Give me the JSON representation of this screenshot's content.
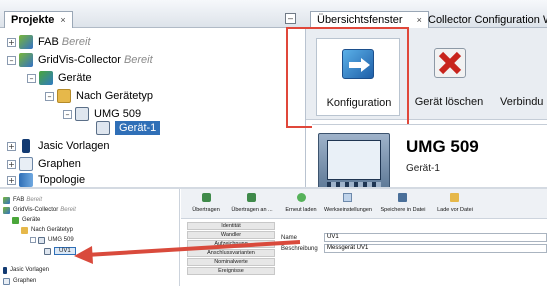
{
  "top_left": {
    "panel_title": "Projekte",
    "tab_close": "×",
    "minimize": "–",
    "tree": [
      {
        "label": "FAB",
        "status": "Bereit"
      },
      {
        "label": "GridVis-Collector",
        "status": "Bereit"
      },
      {
        "label": "Geräte"
      },
      {
        "label": "Nach Gerätetyp"
      },
      {
        "label": "UMG 509"
      },
      {
        "label": "Gerät-1"
      },
      {
        "label": "Jasic Vorlagen"
      },
      {
        "label": "Graphen"
      },
      {
        "label": "Topologie"
      }
    ]
  },
  "top_right": {
    "tabs": [
      "Übersichtsfenster",
      "Collector Configuration W"
    ],
    "tab_close": "×",
    "toolbar": [
      {
        "label": "Konfiguration",
        "icon": "konfiguration-icon"
      },
      {
        "label": "Gerät löschen",
        "icon": "delete-x-icon"
      },
      {
        "label": "Verbindu"
      }
    ],
    "device_title": "UMG 509",
    "device_subtitle": "Gerät-1"
  },
  "bottom": {
    "tree": [
      {
        "label": "FAB",
        "status": "Bereit"
      },
      {
        "label": "GridVis-Collector",
        "status": "Bereit"
      },
      {
        "label": "Geräte"
      },
      {
        "label": "Nach Gerätetyp"
      },
      {
        "label": "UMG 509"
      },
      {
        "label": "UV1"
      },
      {
        "label": "Jasic Vorlagen"
      },
      {
        "label": "Graphen"
      }
    ],
    "toolbar": [
      "Übertragen",
      "Übertragen an ...",
      "Erneut laden",
      "Werkseinstellungen",
      "Speichere in Datei",
      "Lade vor Datei"
    ],
    "side_tabs": [
      "Identität",
      "Wandler",
      "Aufzeichnung",
      "Anschlussvarianten",
      "Nominalwerte",
      "Ereignisse"
    ],
    "fields": [
      {
        "label": "Name",
        "value": "UV1"
      },
      {
        "label": "Beschreibung",
        "value": "Messgerät UV1"
      }
    ]
  },
  "colors": {
    "highlight_box": "#e0473a",
    "arrow": "#d94a3c",
    "selection": "#2f6fb7"
  }
}
